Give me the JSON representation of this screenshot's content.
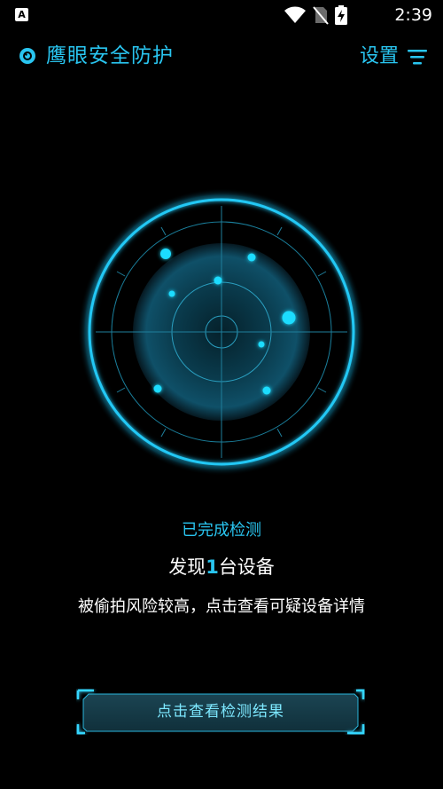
{
  "status_bar": {
    "app_icon_letter": "A",
    "time": "2:39"
  },
  "header": {
    "title": "鹰眼安全防护",
    "settings_label": "设置"
  },
  "radar": {
    "accent_color": "#29c5f0",
    "device_dots": 8
  },
  "result": {
    "status": "已完成检测",
    "found_prefix": "发现",
    "found_count": "1",
    "found_suffix": "台设备",
    "warning": "被偷拍风险较高，点击查看可疑设备详情"
  },
  "button": {
    "label": "点击查看检测结果"
  }
}
